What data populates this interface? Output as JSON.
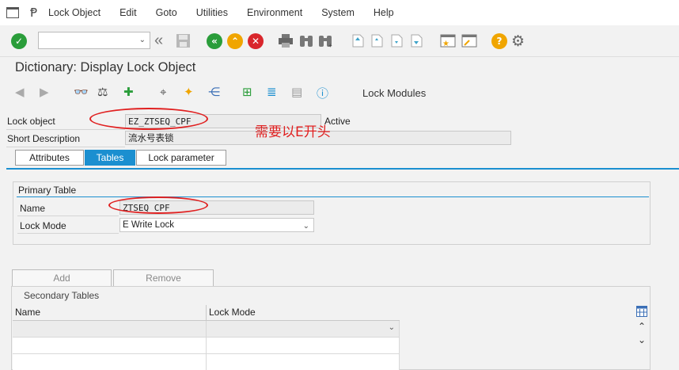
{
  "menu": {
    "items": [
      "Lock Object",
      "Edit",
      "Goto",
      "Utilities",
      "Environment",
      "System",
      "Help"
    ]
  },
  "toolbar": {
    "command_field_value": "",
    "icons": [
      "enter-icon",
      "back-double-icon",
      "save-icon",
      "back-icon",
      "exit-icon",
      "cancel-icon",
      "print-icon",
      "find-icon",
      "find-next-icon",
      "first-page-icon",
      "previous-page-icon",
      "next-page-icon",
      "last-page-icon",
      "create-session-icon",
      "shortcut-icon",
      "help-icon",
      "customize-icon"
    ]
  },
  "screen": {
    "title": "Dictionary: Display Lock Object"
  },
  "app_toolbar": {
    "lock_modules_label": "Lock Modules"
  },
  "form": {
    "lock_object_label": "Lock object",
    "lock_object_value": "EZ_ZTSEQ_CPF",
    "status_value": "Active",
    "short_desc_label": "Short Description",
    "short_desc_value": "流水号表锁"
  },
  "annotation": {
    "text": "需要以E开头"
  },
  "tabs": [
    {
      "label": "Attributes",
      "active": false
    },
    {
      "label": "Tables",
      "active": true
    },
    {
      "label": "Lock parameter",
      "active": false
    }
  ],
  "primary_table": {
    "group_title": "Primary Table",
    "name_label": "Name",
    "name_value": "ZTSEQ_CPF",
    "lock_mode_label": "Lock Mode",
    "lock_mode_value": "E Write Lock"
  },
  "secondary_tables": {
    "add_label": "Add",
    "remove_label": "Remove",
    "title": "Secondary Tables",
    "columns": [
      "Name",
      "Lock Mode"
    ],
    "rows": [
      {
        "name": "",
        "lock_mode": ""
      },
      {
        "name": "",
        "lock_mode": ""
      },
      {
        "name": "",
        "lock_mode": ""
      }
    ]
  },
  "colors": {
    "accent": "#1b8fd0",
    "annotation": "#e02020",
    "enter_green": "#2a9d3a",
    "back_green": "#2a9d3a",
    "exit_orange": "#f0a500",
    "cancel_red": "#d9262c",
    "help_orange": "#f0a500"
  }
}
